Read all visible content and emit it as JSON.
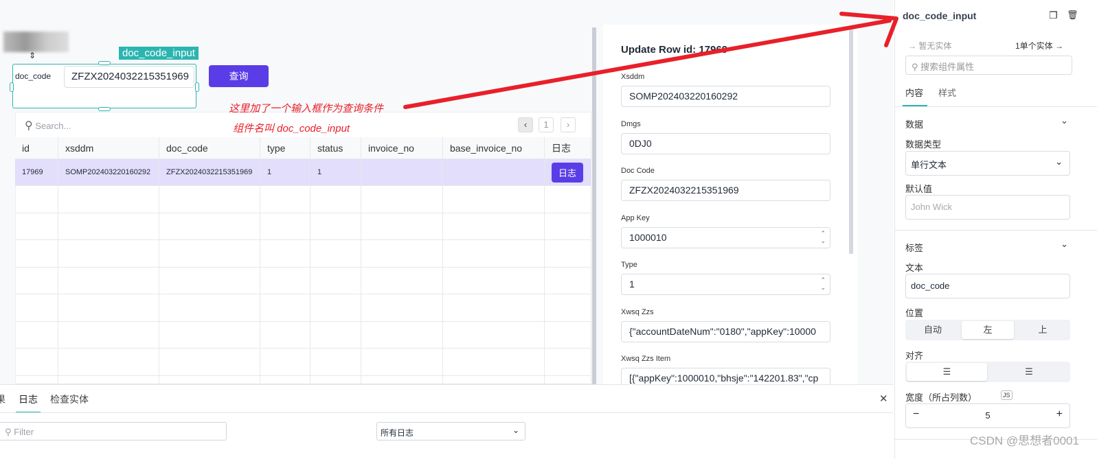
{
  "canvas": {
    "component_tag": "doc_code_input",
    "input_label": "doc_code",
    "input_value": "ZFZX2024032215351969",
    "query_button": "查询",
    "annotation_line1": "这里加了一个输入框作为查询条件",
    "annotation_line2": "组件名叫  doc_code_input",
    "search_placeholder": "Search...",
    "page": "1",
    "columns": [
      "id",
      "xsddm",
      "doc_code",
      "type",
      "status",
      "invoice_no",
      "base_invoice_no",
      "日志"
    ],
    "rows": [
      [
        "17969",
        "SOMP202403220160292",
        "ZFZX2024032215351969",
        "1",
        "1",
        "",
        "",
        "日志"
      ]
    ]
  },
  "form": {
    "title": "Update Row id: 17969",
    "fields": [
      {
        "label": "Xsddm",
        "value": "SOMP202403220160292"
      },
      {
        "label": "Dmgs",
        "value": "0DJ0"
      },
      {
        "label": "Doc Code",
        "value": "ZFZX2024032215351969"
      },
      {
        "label": "App Key",
        "value": "1000010"
      },
      {
        "label": "Type",
        "value": "1"
      },
      {
        "label": "Xwsq Zzs",
        "value": "{\"accountDateNum\":\"0180\",\"appKey\":10000"
      },
      {
        "label": "Xwsq Zzs Item",
        "value": "[{\"appKey\":1000010,\"bhsje\":\"142201.83\",\"cp"
      }
    ]
  },
  "bottom": {
    "tabs": [
      "果",
      "日志",
      "检查实体"
    ],
    "active_tab": "日志",
    "filter_placeholder": "Filter",
    "log_select": "所有日志"
  },
  "inspector": {
    "title": "doc_code_input",
    "no_entity": "暂无实体",
    "entity_count": "1单个实体",
    "search_placeholder": "搜索组件属性",
    "tabs": [
      "内容",
      "样式"
    ],
    "data_section": "数据",
    "data_type_label": "数据类型",
    "data_type_value": "单行文本",
    "default_label": "默认值",
    "default_placeholder": "John Wick",
    "label_section": "标签",
    "text_label": "文本",
    "text_value": "doc_code",
    "position_label": "位置",
    "position_options": [
      "自动",
      "左",
      "上"
    ],
    "position_selected": "左",
    "align_label": "对齐",
    "width_label": "宽度（所占列数）",
    "js_badge": "JS",
    "width_value": "5"
  },
  "watermark": "CSDN @思想者0001",
  "colors": {
    "accent": "#2bb5b0",
    "primary": "#5a3de6",
    "row_highlight": "#e3defb",
    "annotation": "#e8202a"
  }
}
